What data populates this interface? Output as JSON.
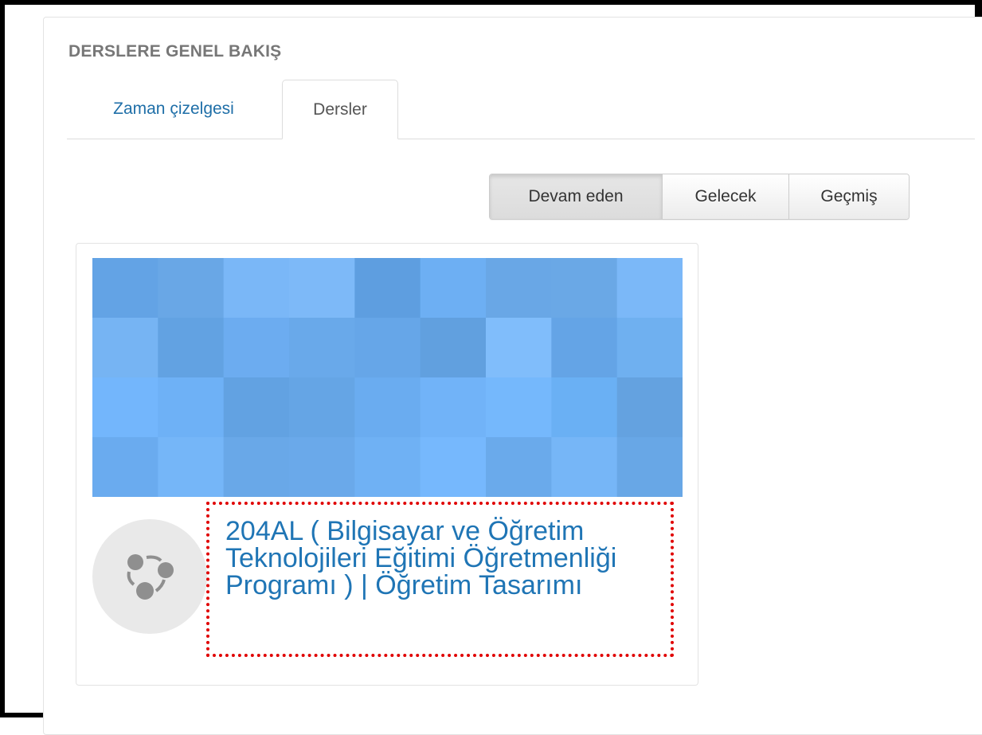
{
  "block": {
    "title": "DERSLERE GENEL BAKIŞ"
  },
  "tabs": [
    {
      "label": "Zaman çizelgesi",
      "active": false
    },
    {
      "label": "Dersler",
      "active": true
    }
  ],
  "filters": {
    "current_label": "Devam eden",
    "future_label": "Gelecek",
    "past_label": "Geçmiş",
    "selected": "Devam eden"
  },
  "course": {
    "title": "204AL ( Bilgisayar ve Öğretim Teknolojileri Eğitimi Öğretmenliği Programı ) | Öğretim Tasarımı",
    "icon": "course-category-icon",
    "image_colors": [
      [
        "#63a3e5",
        "#69a7e6",
        "#7ab7f7",
        "#7db9f8",
        "#5e9ee0",
        "#6daff3",
        "#69a7e6",
        "#6aa8e6",
        "#7bb8f8"
      ],
      [
        "#76b4f3",
        "#62a2e2",
        "#6cacf0",
        "#69a9ea",
        "#66a6e8",
        "#61a0df",
        "#80bdfb",
        "#64a4e6",
        "#6fb0f0"
      ],
      [
        "#73b6fc",
        "#6eb1f6",
        "#62a2e2",
        "#65a5e5",
        "#6aacf0",
        "#71b3f8",
        "#75b8fc",
        "#6ab0f4",
        "#64a2e0"
      ],
      [
        "#6aabef",
        "#75b6f8",
        "#69a8e8",
        "#6aa9ea",
        "#6fb1f4",
        "#76b8fd",
        "#6aaaeb",
        "#76b6f7",
        "#68a7e6"
      ]
    ]
  },
  "colors": {
    "link": "#1f75b5",
    "tab_link": "#1f6fa8",
    "heading": "#777777",
    "annotation": "#e00000"
  }
}
